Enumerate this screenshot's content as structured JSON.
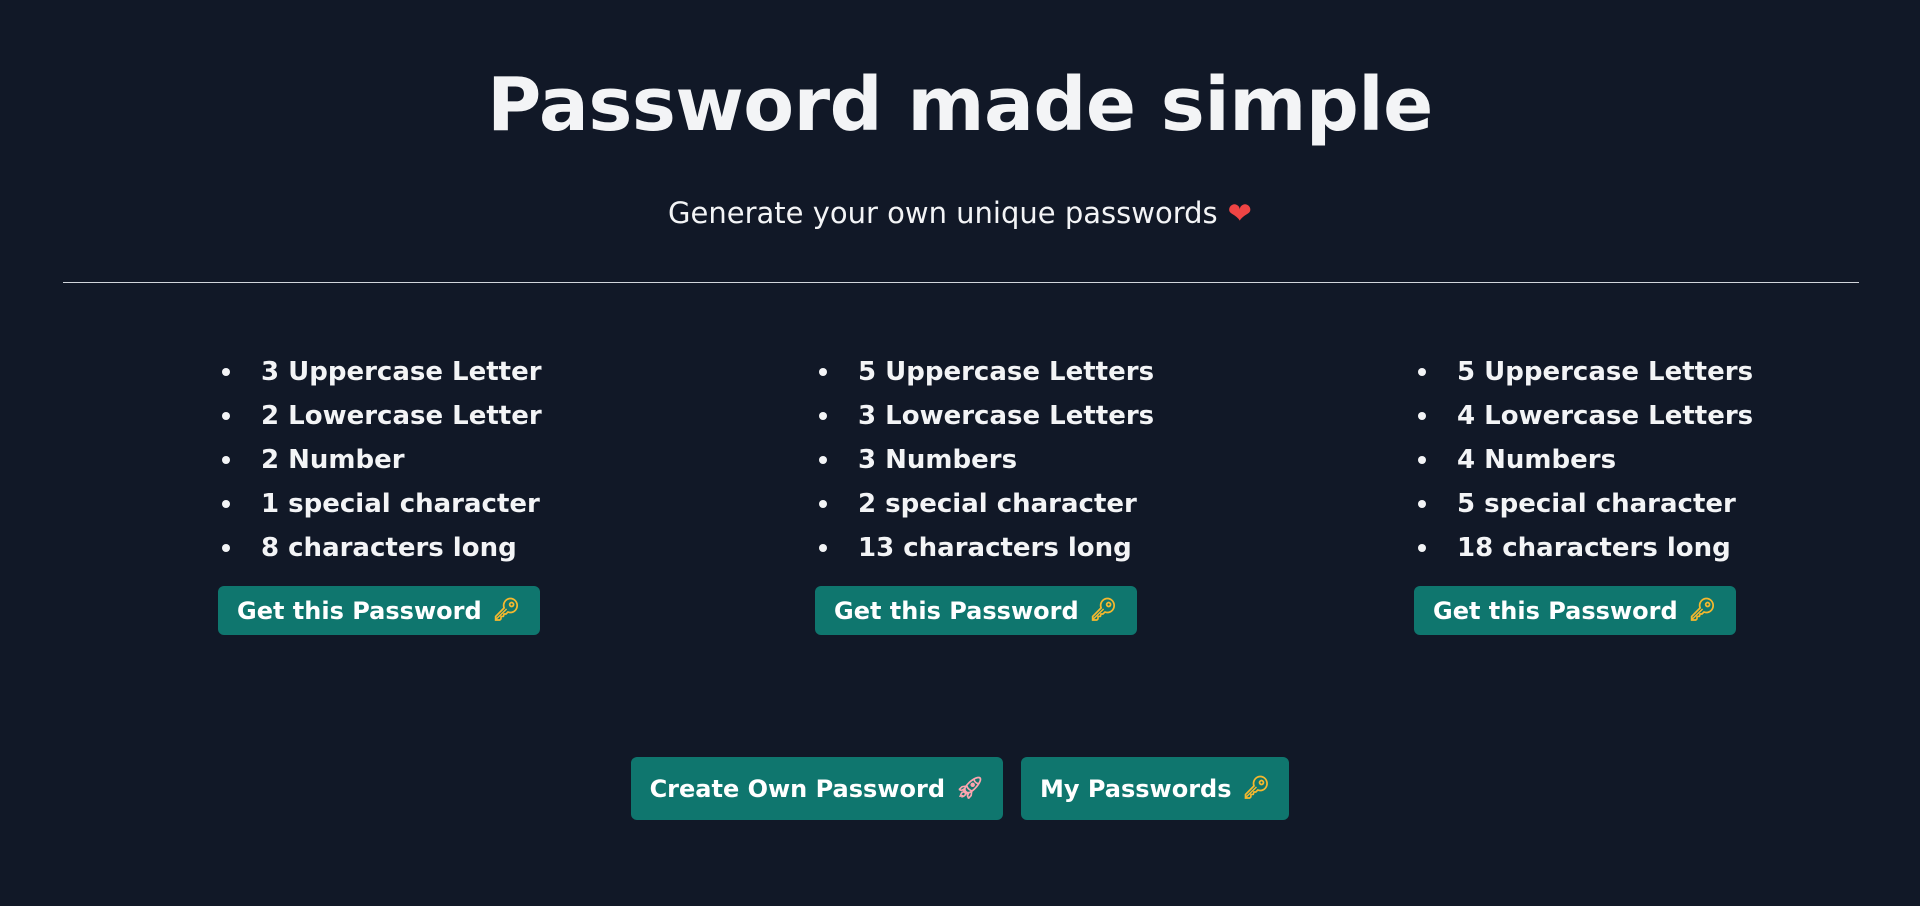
{
  "header": {
    "title": "Password made simple",
    "subtitle": "Generate your own unique passwords",
    "subtitle_icon": "heart-icon"
  },
  "presets": [
    {
      "features": [
        "3 Uppercase Letter",
        "2 Lowercase Letter",
        "2 Number",
        "1 special character",
        "8 characters long"
      ],
      "button_label": "Get this Password",
      "button_icon": "key-icon"
    },
    {
      "features": [
        "5 Uppercase Letters",
        "3 Lowercase Letters",
        "3 Numbers",
        "2 special character",
        "13 characters long"
      ],
      "button_label": "Get this Password",
      "button_icon": "key-icon"
    },
    {
      "features": [
        "5 Uppercase Letters",
        "4 Lowercase Letters",
        "4 Numbers",
        "5 special character",
        "18 characters long"
      ],
      "button_label": "Get this Password",
      "button_icon": "key-icon"
    }
  ],
  "actions": {
    "create_label": "Create Own Password",
    "create_icon": "rocket-icon",
    "my_passwords_label": "My Passwords",
    "my_passwords_icon": "key-icon"
  },
  "colors": {
    "background": "#111827",
    "text": "#f3f4f6",
    "button": "#0f766e",
    "heart": "#ef4444",
    "key": "#f5b82e"
  }
}
